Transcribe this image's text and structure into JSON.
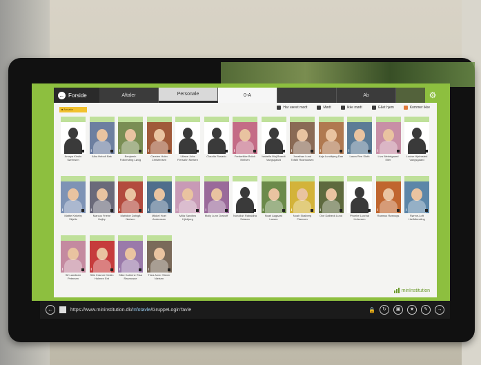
{
  "app": {
    "home_label": "Forside",
    "tabs": [
      {
        "label": "Aftaler"
      },
      {
        "label": "Personale"
      },
      {
        "label": "0-A"
      },
      {
        "label": ""
      },
      {
        "label": "Ab"
      }
    ]
  },
  "toolbar": {
    "badge": "■ Ansatte",
    "filters": [
      "Har været mødt",
      "Mødt",
      "Ikke mødt",
      "Gået hjem",
      "Kommer ikke"
    ]
  },
  "children": [
    {
      "name": "Amaya Kirstin Sørensen",
      "photo": "silhouette"
    },
    {
      "name": "Alba Hebolt Bak",
      "photo": "photo",
      "color": "#6d7fa0"
    },
    {
      "name": "Benjamin Folkersting Løvig",
      "photo": "photo",
      "color": "#7a8e54"
    },
    {
      "name": "Carsten Holm Christensen",
      "photo": "photo",
      "color": "#a05a3a"
    },
    {
      "name": "Liliane Jobs Fiersahn Nielsen",
      "photo": "silhouette"
    },
    {
      "name": "Claudia Rosario",
      "photo": "silhouette"
    },
    {
      "name": "Frederikke Brück Nielsen",
      "photo": "photo",
      "color": "#c46c86"
    },
    {
      "name": "Isabella Maj Brandt Vangsgaard",
      "photo": "silhouette"
    },
    {
      "name": "Jonathan Lund Tofahl Rasmussen",
      "photo": "photo",
      "color": "#8a6a55"
    },
    {
      "name": "Kaja Lundbjerg Dan",
      "photo": "photo",
      "color": "#b07950"
    },
    {
      "name": "Laura Ree Sloth",
      "photo": "photo",
      "color": "#5c7c96"
    },
    {
      "name": "Liva Wedelgaard Eller",
      "photo": "photo",
      "color": "#c88fa6"
    },
    {
      "name": "Louise Hjelmsted Vangsgaard",
      "photo": "silhouette"
    },
    {
      "name": "Mattie Kirkeby Skjelle",
      "photo": "photo",
      "color": "#7e93b5"
    },
    {
      "name": "Marcus Friehe Højby",
      "photo": "photo",
      "color": "#6a6a7a"
    },
    {
      "name": "Mathilde Dahlgå Nielsen",
      "photo": "photo",
      "color": "#b34b3e"
    },
    {
      "name": "Mikkel Hoel Andreasen",
      "photo": "photo",
      "color": "#4f6e8c"
    },
    {
      "name": "Milla Sandbro Hjlebjerg",
      "photo": "photo",
      "color": "#c89ab6"
    },
    {
      "name": "Molly Lunn Draboff",
      "photo": "photo",
      "color": "#9a6a9a"
    },
    {
      "name": "Nohollah Rabaldha Solaran",
      "photo": "silhouette"
    },
    {
      "name": "Noah Aagaard Larsen",
      "photo": "photo",
      "color": "#6b8a4a"
    },
    {
      "name": "Noah Skalberg Plamsen",
      "photo": "photo",
      "color": "#d3b33a"
    },
    {
      "name": "Ove Dalbeck Lund",
      "photo": "photo",
      "color": "#5e6a3e"
    },
    {
      "name": "Phoebe Lurzhal Hofsveen",
      "photo": "silhouette"
    },
    {
      "name": "Rasmus Røsnogs",
      "photo": "photo",
      "color": "#c0662f"
    },
    {
      "name": "Rønne-Loft Høffdfensling",
      "photo": "photo",
      "color": "#5c86a8"
    },
    {
      "name": "Sif Landkohr Petersen",
      "photo": "photo",
      "color": "#c48aa0"
    },
    {
      "name": "Silie Kramer Kirstin Holmen Ent",
      "photo": "photo",
      "color": "#c63c3c"
    },
    {
      "name": "Silke Kathrine Risa Rasmusse",
      "photo": "photo",
      "color": "#9a7aaa"
    },
    {
      "name": "Thea Amer Stener Nielsen",
      "photo": "photo",
      "color": "#7a6a5a"
    }
  ],
  "logo": {
    "text": "minInstitution"
  },
  "browser": {
    "url_prefix": "https://www.mininstitution.dk/",
    "url_highlight": "Infotavle",
    "url_suffix": "/GruppeLoginTavle"
  }
}
